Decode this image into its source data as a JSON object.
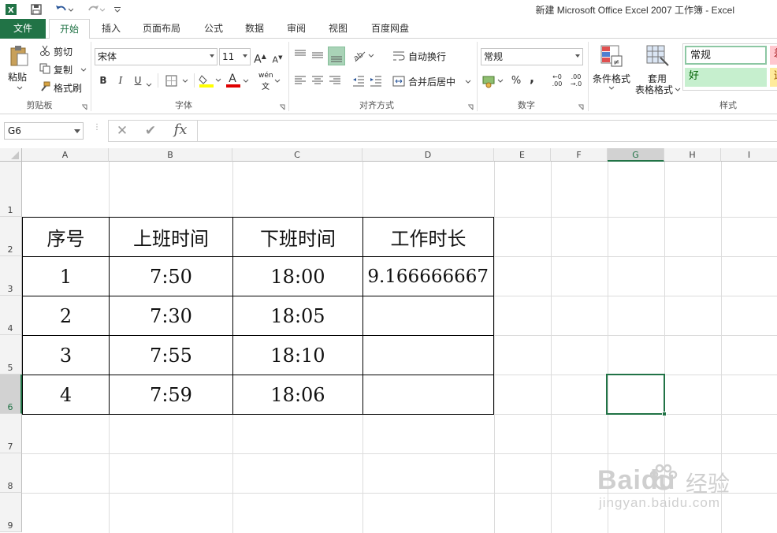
{
  "title_bar": {
    "title": "新建 Microsoft Office Excel 2007 工作簿 - Excel"
  },
  "tabs": [
    {
      "label": "文件"
    },
    {
      "label": "开始"
    },
    {
      "label": "插入"
    },
    {
      "label": "页面布局"
    },
    {
      "label": "公式"
    },
    {
      "label": "数据"
    },
    {
      "label": "审阅"
    },
    {
      "label": "视图"
    },
    {
      "label": "百度网盘"
    }
  ],
  "ribbon": {
    "clipboard": {
      "paste": "粘贴",
      "cut": "剪切",
      "copy": "复制",
      "format_painter": "格式刷",
      "group_label": "剪贴板"
    },
    "font": {
      "font_name": "宋体",
      "font_size": "11",
      "grow": "A",
      "shrink": "A",
      "bold": "B",
      "italic": "I",
      "underline": "U",
      "font_color": "A",
      "phonetic": "wén",
      "group_label": "字体"
    },
    "alignment": {
      "wrap_text": "自动换行",
      "merge_center": "合并后居中",
      "group_label": "对齐方式"
    },
    "number": {
      "format": "常规",
      "percent": "%",
      "comma": ",",
      "inc_decimal_top": "←0",
      "inc_decimal_bottom": ".00",
      "dec_decimal_top": ".00",
      "dec_decimal_bottom": "→.0",
      "group_label": "数字"
    },
    "styles": {
      "conditional_format": "条件格式",
      "table_format_line1": "套用",
      "table_format_line2": "表格格式",
      "normal": "常规",
      "good": "好",
      "bad_partial": "差",
      "neutral_partial": "适",
      "group_label": "样式"
    },
    "colors": {
      "accent": "#217346",
      "good_bg": "#c6efce",
      "good_fg": "#006100",
      "bad_bg": "#ffc7ce",
      "neutral_bg": "#ffeb9c"
    }
  },
  "formula_bar": {
    "name_box": "G6",
    "cancel": "✕",
    "enter": "✔",
    "fx": "fx",
    "content": ""
  },
  "sheet": {
    "columns": [
      "A",
      "B",
      "C",
      "D",
      "E",
      "F",
      "G",
      "H",
      "I"
    ],
    "rows": [
      "1",
      "2",
      "3",
      "4",
      "5",
      "6",
      "7",
      "8",
      "9"
    ],
    "selected_cell": "G6",
    "header": [
      "序号",
      "上班时间",
      "下班时间",
      "工作时长"
    ],
    "data": [
      [
        "1",
        "7:50",
        "18:00",
        "9.166666667"
      ],
      [
        "2",
        "7:30",
        "18:05",
        ""
      ],
      [
        "3",
        "7:55",
        "18:10",
        ""
      ],
      [
        "4",
        "7:59",
        "18:06",
        ""
      ]
    ]
  },
  "watermark": {
    "brand": "Baidu",
    "cn": "经验",
    "url": "jingyan.baidu.com"
  }
}
